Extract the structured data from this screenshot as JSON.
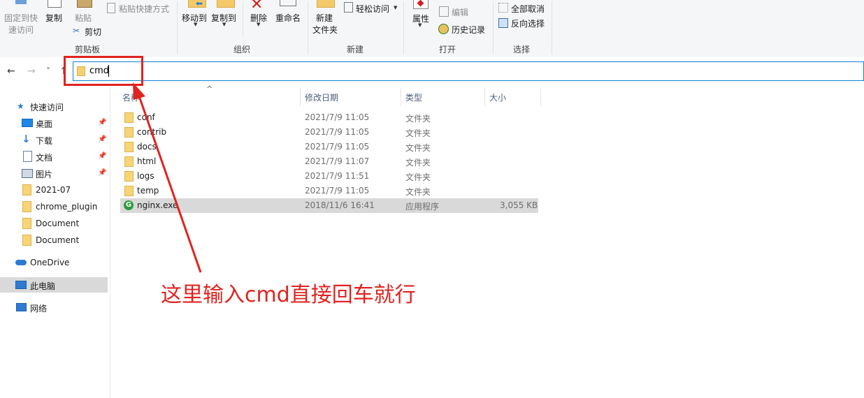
{
  "ribbon": {
    "pin_quick_access_line1": "固定到快",
    "pin_quick_access_line2": "速访问",
    "copy": "复制",
    "paste": "粘贴",
    "paste_shortcut": "粘贴快捷方式",
    "cut": "剪切",
    "clipboard_group": "剪贴板",
    "move_to": "移动到",
    "copy_to": "复制到",
    "delete": "删除",
    "rename": "重命名",
    "organize_group": "组织",
    "new_folder_line1": "新建",
    "new_folder_line2": "文件夹",
    "easy_access": "轻松访问",
    "new_group": "新建",
    "properties": "属性",
    "edit": "编辑",
    "history": "历史记录",
    "open_group": "打开",
    "select_none": "全部取消",
    "invert_selection": "反向选择",
    "select_group": "选择"
  },
  "nav": {
    "back": "←",
    "forward": "→",
    "recent": "˅",
    "up": "↑",
    "address_value": "cmd"
  },
  "sidebar": {
    "quick_access": "快速访问",
    "items": [
      {
        "label": "桌面",
        "icon": "desktop-icon",
        "pinned": true
      },
      {
        "label": "下载",
        "icon": "download-icon",
        "pinned": true
      },
      {
        "label": "文档",
        "icon": "document-icon",
        "pinned": true
      },
      {
        "label": "图片",
        "icon": "picture-icon",
        "pinned": true
      },
      {
        "label": "2021-07",
        "icon": "folder-icon",
        "pinned": false
      },
      {
        "label": "chrome_plugin",
        "icon": "folder-icon",
        "pinned": false
      },
      {
        "label": "Document",
        "icon": "folder-icon",
        "pinned": false
      },
      {
        "label": "Document",
        "icon": "folder-icon",
        "pinned": false
      }
    ],
    "onedrive": "OneDrive",
    "this_pc": "此电脑",
    "network": "网络",
    "pin_glyph": "📌"
  },
  "columns": {
    "name": "名称",
    "date": "修改日期",
    "type": "类型",
    "size": "大小",
    "sort_glyph": "^"
  },
  "files": [
    {
      "name": "conf",
      "date": "2021/7/9 11:05",
      "type": "文件夹",
      "size": ""
    },
    {
      "name": "contrib",
      "date": "2021/7/9 11:05",
      "type": "文件夹",
      "size": ""
    },
    {
      "name": "docs",
      "date": "2021/7/9 11:05",
      "type": "文件夹",
      "size": ""
    },
    {
      "name": "html",
      "date": "2021/7/9 11:07",
      "type": "文件夹",
      "size": ""
    },
    {
      "name": "logs",
      "date": "2021/7/9 11:51",
      "type": "文件夹",
      "size": ""
    },
    {
      "name": "temp",
      "date": "2021/7/9 11:05",
      "type": "文件夹",
      "size": ""
    },
    {
      "name": "nginx.exe",
      "date": "2018/11/6 16:41",
      "type": "应用程序",
      "size": "3,055 KB"
    }
  ],
  "annotation": {
    "text": "这里输入cmd直接回车就行",
    "color": "#e0231f"
  },
  "colors": {
    "accent": "#0a84d6",
    "selection": "#d9d9d9",
    "folder": "#f7d577"
  }
}
